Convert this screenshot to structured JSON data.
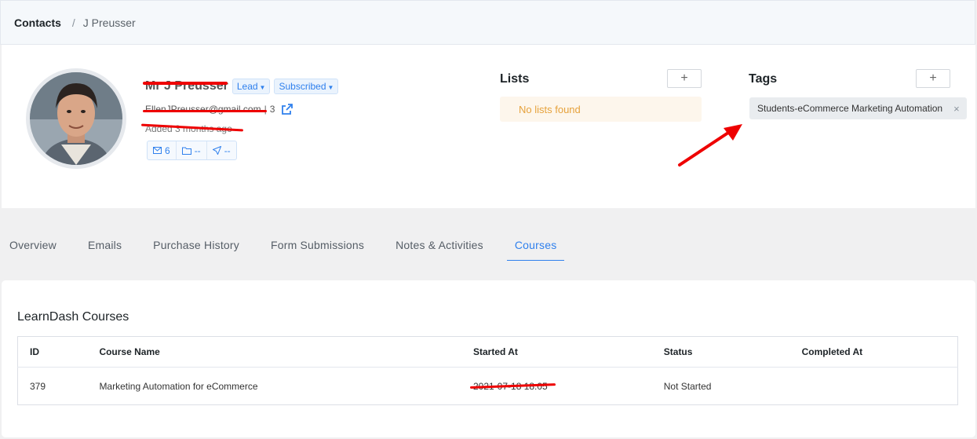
{
  "breadcrumb": {
    "root": "Contacts",
    "separator": "/",
    "current": "J Preusser"
  },
  "contact": {
    "name": "Mr J Preusser",
    "status_badge": "Lead",
    "subscription_badge": "Subscribed",
    "email": "EllenJPreusser@gmail.com",
    "email_count": "3",
    "added": "Added 3 months ago",
    "stats": {
      "emails": "6",
      "lists": "--",
      "campaigns": "--"
    }
  },
  "lists": {
    "title": "Lists",
    "add_label": "+",
    "empty_message": "No lists found"
  },
  "tags": {
    "title": "Tags",
    "add_label": "+",
    "items": [
      "Students-eCommerce Marketing Automation"
    ],
    "remove_label": "×"
  },
  "tabs": [
    "Overview",
    "Emails",
    "Purchase History",
    "Form Submissions",
    "Notes & Activities",
    "Courses"
  ],
  "active_tab": "Courses",
  "courses": {
    "title": "LearnDash Courses",
    "columns": [
      "ID",
      "Course Name",
      "Started At",
      "Status",
      "Completed At"
    ],
    "rows": [
      {
        "id": "379",
        "name": "Marketing Automation for eCommerce",
        "started_at": "2021-07-18 18:05",
        "status": "Not Started",
        "completed_at": ""
      }
    ]
  },
  "colors": {
    "accent": "#2f80ed",
    "annotation": "#e00000",
    "warning": "#e6a23c"
  }
}
